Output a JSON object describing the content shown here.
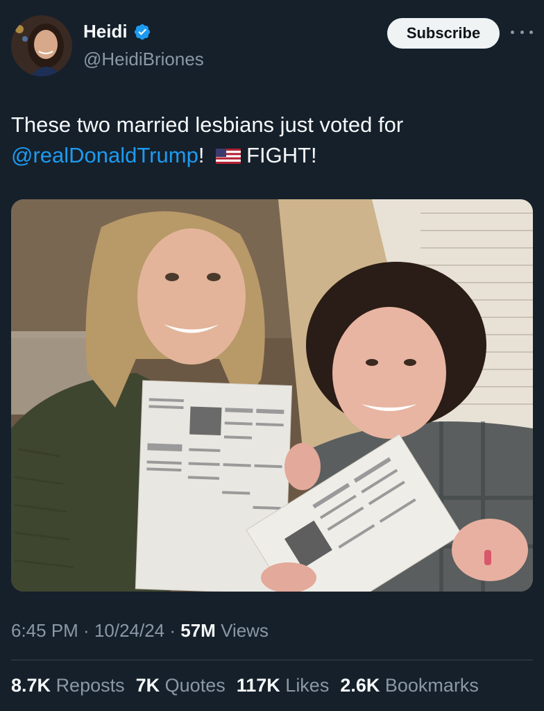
{
  "author": {
    "display_name": "Heidi",
    "handle": "@HeidiBriones",
    "verified": true,
    "avatar_icon": "profile-photo"
  },
  "header": {
    "subscribe_label": "Subscribe",
    "more_icon": "more-horizontal-icon"
  },
  "tweet": {
    "text_line1": "These two married lesbians just voted for",
    "mention": "@realDonaldTrump",
    "text_after_mention": "!",
    "flag_emoji": "us-flag",
    "text_end": "FIGHT!",
    "image_alt": "Two women smiling holding official ballots"
  },
  "meta": {
    "time": "6:45 PM",
    "sep1": " · ",
    "date": "10/24/24",
    "sep2": " · ",
    "views_count": "57M",
    "views_label": " Views"
  },
  "stats": [
    {
      "count": "8.7K",
      "label": "Reposts"
    },
    {
      "count": "7K",
      "label": "Quotes"
    },
    {
      "count": "117K",
      "label": "Likes"
    },
    {
      "count": "2.6K",
      "label": "Bookmarks"
    }
  ],
  "colors": {
    "background": "#15202b",
    "accent": "#1d9bf0",
    "muted": "#8b98a5"
  }
}
